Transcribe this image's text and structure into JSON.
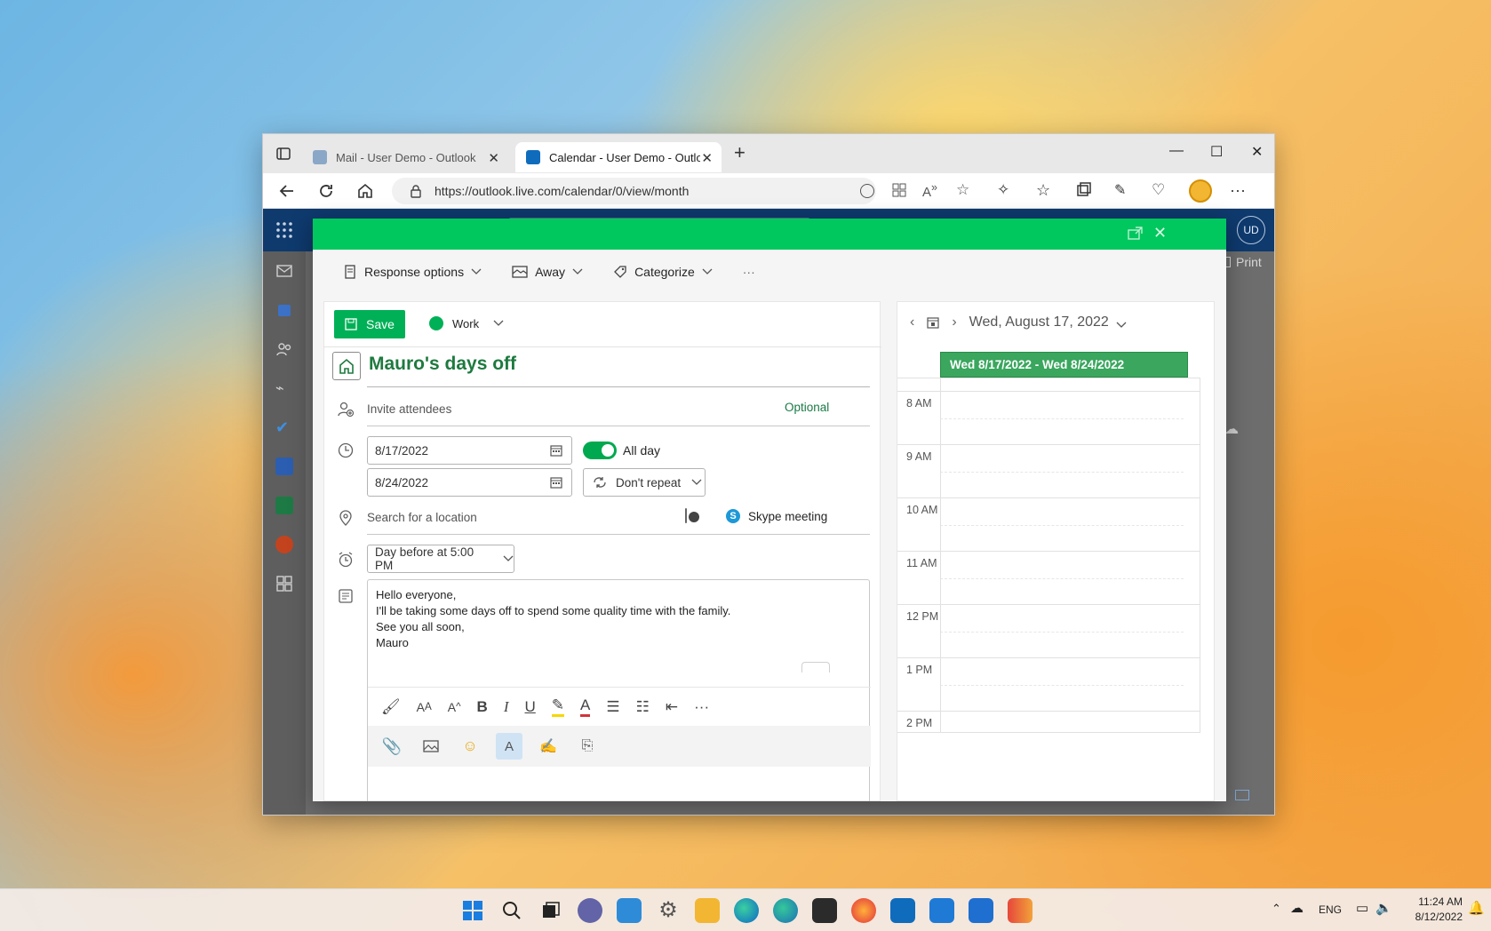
{
  "browser": {
    "tabs": [
      {
        "title": "Mail - User Demo - Outlook",
        "active": false
      },
      {
        "title": "Calendar - User Demo - Outlool",
        "active": true
      }
    ],
    "url": "https://outlook.live.com/calendar/0/view/month",
    "new_tab_glyph": "+"
  },
  "owa": {
    "avatar_initials": "UD",
    "print_label": "Print"
  },
  "dialog": {
    "commands": {
      "response_options": "Response options",
      "show_as": "Away",
      "categorize": "Categorize",
      "more": "···"
    },
    "save_label": "Save",
    "category": "Work",
    "title": "Mauro's days off",
    "invite_placeholder": "Invite attendees",
    "optional_label": "Optional",
    "start_date": "8/17/2022",
    "end_date": "8/24/2022",
    "all_day_label": "All day",
    "all_day_on": true,
    "repeat": "Don't repeat",
    "location_placeholder": "Search for a location",
    "skype_label": "Skype meeting",
    "skype_on": false,
    "reminder": "Day before at 5:00 PM",
    "body_lines": [
      "Hello everyone,",
      "I'll be taking some days off to spend some quality time with the family.",
      "See you all soon,",
      "Mauro"
    ]
  },
  "day_view": {
    "date_label": "Wed, August 17, 2022",
    "all_day_event": "Wed 8/17/2022 - Wed 8/24/2022",
    "hours": [
      "8 AM",
      "9 AM",
      "10 AM",
      "11 AM",
      "12 PM",
      "1 PM",
      "2 PM"
    ]
  },
  "taskbar": {
    "language": "ENG",
    "time": "11:24 AM",
    "date": "8/12/2022"
  },
  "colors": {
    "accent_green": "#00c75e",
    "save_green": "#00b057",
    "owa_blue": "#0e3a6e"
  }
}
